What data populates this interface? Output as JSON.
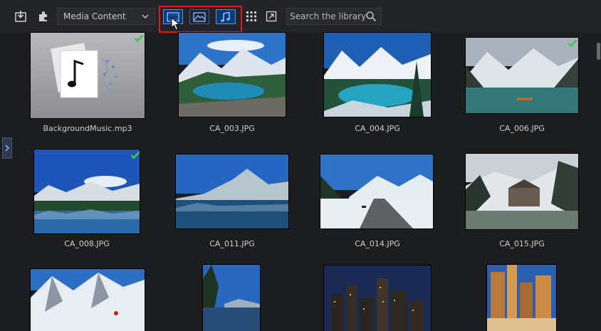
{
  "toolbar": {
    "import_icon": "import-icon",
    "plugin_icon": "puzzle-icon",
    "media_dropdown": {
      "selected": "Media Content"
    },
    "filters": [
      {
        "name": "video",
        "icon": "film-icon",
        "active": true
      },
      {
        "name": "image",
        "icon": "image-icon",
        "active": false
      },
      {
        "name": "audio",
        "icon": "music-icon",
        "active": true
      }
    ],
    "grid_icon": "grid-view-icon",
    "expand_icon": "expand-icon",
    "search": {
      "placeholder": "Search the library"
    }
  },
  "colors": {
    "highlight_border": "#e0191d",
    "check_green": "#3dc94a",
    "accent_blue": "#4a8fe0"
  },
  "library": {
    "items": [
      {
        "caption": "BackgroundMusic.mp3",
        "type": "audio",
        "used": true
      },
      {
        "caption": "CA_003.JPG",
        "type": "image",
        "used": false
      },
      {
        "caption": "CA_004.JPG",
        "type": "image",
        "used": false
      },
      {
        "caption": "CA_006.JPG",
        "type": "image",
        "used": true
      },
      {
        "caption": "CA_008.JPG",
        "type": "image",
        "used": true
      },
      {
        "caption": "CA_011.JPG",
        "type": "image",
        "used": false
      },
      {
        "caption": "CA_014.JPG",
        "type": "image",
        "used": false
      },
      {
        "caption": "CA_015.JPG",
        "type": "image",
        "used": false
      },
      {
        "caption": "",
        "type": "image",
        "used": false
      },
      {
        "caption": "",
        "type": "image",
        "used": false
      },
      {
        "caption": "",
        "type": "image",
        "used": false
      },
      {
        "caption": "",
        "type": "image",
        "used": false
      }
    ]
  }
}
